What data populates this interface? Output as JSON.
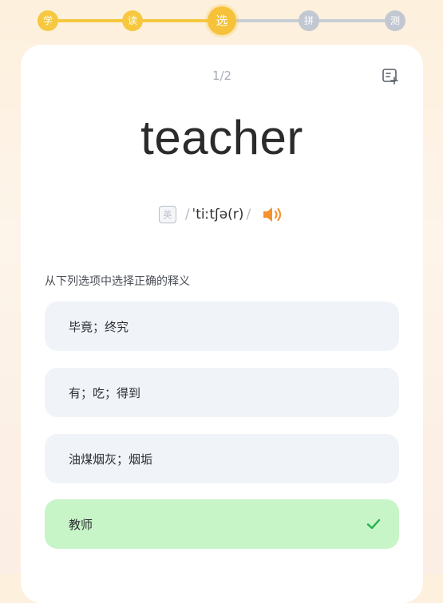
{
  "steps": [
    {
      "label": "学",
      "state": "done"
    },
    {
      "label": "读",
      "state": "done"
    },
    {
      "label": "选",
      "state": "current"
    },
    {
      "label": "拼",
      "state": "todo"
    },
    {
      "label": "测",
      "state": "todo"
    }
  ],
  "card": {
    "counter": "1/2",
    "word": "teacher",
    "accent_badge": "英",
    "slash": "/",
    "phonetic": "ˈtiːtʃə(r)",
    "prompt": "从下列选项中选择正确的释义",
    "options": [
      {
        "text": "毕竟；终究",
        "correct": false
      },
      {
        "text": "有；吃；得到",
        "correct": false
      },
      {
        "text": "油煤烟灰；烟垢",
        "correct": false
      },
      {
        "text": "教师",
        "correct": true
      }
    ]
  },
  "icons": {
    "corner": "flashcard-icon",
    "audio": "speaker-icon",
    "correct": "check-icon"
  },
  "colors": {
    "progress_done": "#f6c83f",
    "progress_todo": "#c2c8d2",
    "speaker": "#f5922d",
    "correct_bg": "#c7f5c7",
    "check": "#22b14c"
  }
}
